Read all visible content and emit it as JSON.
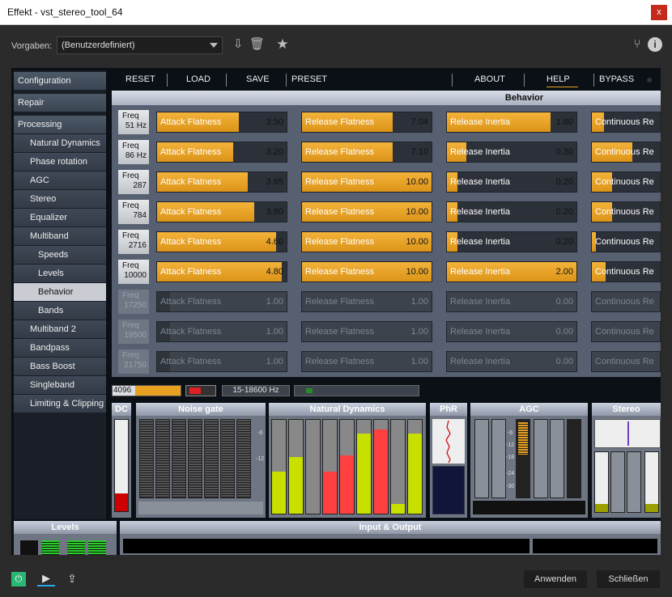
{
  "window": {
    "title": "Effekt - vst_stereo_tool_64",
    "close": "x"
  },
  "presets": {
    "label": "Vorgaben:",
    "value": "(Benutzerdefiniert)"
  },
  "menu": {
    "reset": "RESET",
    "load": "LOAD",
    "save": "SAVE",
    "preset": "PRESET",
    "about": "ABOUT",
    "help": "HELP",
    "bypass": "BYPASS"
  },
  "sidebar": [
    {
      "label": "Configuration",
      "sub": 0
    },
    {
      "label": "Repair",
      "sub": 0
    },
    {
      "label": "Processing",
      "sub": 0
    },
    {
      "label": "Natural Dynamics",
      "sub": 1
    },
    {
      "label": "Phase rotation",
      "sub": 1
    },
    {
      "label": "AGC",
      "sub": 1
    },
    {
      "label": "Stereo",
      "sub": 1
    },
    {
      "label": "Equalizer",
      "sub": 1
    },
    {
      "label": "Multiband",
      "sub": 1
    },
    {
      "label": "Speeds",
      "sub": 2
    },
    {
      "label": "Levels",
      "sub": 2
    },
    {
      "label": "Behavior",
      "sub": 2
    },
    {
      "label": "Bands",
      "sub": 2
    },
    {
      "label": "Multiband 2",
      "sub": 1
    },
    {
      "label": "Bandpass",
      "sub": 1
    },
    {
      "label": "Bass Boost",
      "sub": 1
    },
    {
      "label": "Singleband",
      "sub": 1
    },
    {
      "label": "Limiting & Clipping",
      "sub": 1
    }
  ],
  "panel": {
    "title": "Behavior"
  },
  "rows": [
    {
      "freq": "Freq",
      "hz": "51 Hz",
      "af": "3.50",
      "afp": 0.63,
      "rf": "7.04",
      "rfp": 0.7,
      "ri": "1.60",
      "rip": 0.8,
      "cr": 0.18,
      "dis": false
    },
    {
      "freq": "Freq",
      "hz": "86 Hz",
      "af": "3.20",
      "afp": 0.59,
      "rf": "7.10",
      "rfp": 0.7,
      "ri": "0.30",
      "rip": 0.15,
      "cr": 0.6,
      "dis": false
    },
    {
      "freq": "Freq",
      "hz": "287",
      "af": "3.65",
      "afp": 0.7,
      "rf": "10.00",
      "rfp": 1,
      "ri": "0.20",
      "rip": 0.08,
      "cr": 0.3,
      "dis": false
    },
    {
      "freq": "Freq",
      "hz": "784",
      "af": "3.90",
      "afp": 0.75,
      "rf": "10.00",
      "rfp": 1,
      "ri": "0.20",
      "rip": 0.08,
      "cr": 0.3,
      "dis": false
    },
    {
      "freq": "Freq",
      "hz": "2716",
      "af": "4.60",
      "afp": 0.92,
      "rf": "10.00",
      "rfp": 1,
      "ri": "0.20",
      "rip": 0.08,
      "cr": 0.06,
      "dis": false
    },
    {
      "freq": "Freq",
      "hz": "10000",
      "af": "4.80",
      "afp": 0.96,
      "rf": "10.00",
      "rfp": 1,
      "ri": "2.00",
      "rip": 1,
      "cr": 0.2,
      "dis": false
    },
    {
      "freq": "Freq",
      "hz": "17250",
      "af": "1.00",
      "afp": 0.1,
      "rf": "1.00",
      "rfp": 0,
      "ri": "0.00",
      "rip": 0,
      "cr": 0,
      "dis": true
    },
    {
      "freq": "Freq",
      "hz": "19500",
      "af": "1.00",
      "afp": 0.1,
      "rf": "1.00",
      "rfp": 0,
      "ri": "0.00",
      "rip": 0,
      "cr": 0,
      "dis": true
    },
    {
      "freq": "Freq",
      "hz": "21750",
      "af": "1.00",
      "afp": 0.1,
      "rf": "1.00",
      "rfp": 0,
      "ri": "0.00",
      "rip": 0,
      "cr": 0,
      "dis": true
    }
  ],
  "labels": {
    "af": "Attack Flatness",
    "rf": "Release Flatness",
    "ri": "Release Inertia",
    "cr": "Continuous Re"
  },
  "status": {
    "samples": "4096",
    "band": "15-18600 Hz"
  },
  "meters": {
    "dc": "DC",
    "noise": "Noise gate",
    "nd": "Natural Dynamics",
    "phr": "PhR",
    "agc": "AGC",
    "stereo": "Stereo",
    "levels": "Levels",
    "io": "Input & Output",
    "m6": "-6",
    "m12": "-12",
    "m18": "-18",
    "m24": "-24",
    "m30": "-30"
  },
  "buttons": {
    "apply": "Anwenden",
    "close": "Schließen"
  },
  "colors": {
    "accent": "#e8a020",
    "power": "#2bb673"
  }
}
